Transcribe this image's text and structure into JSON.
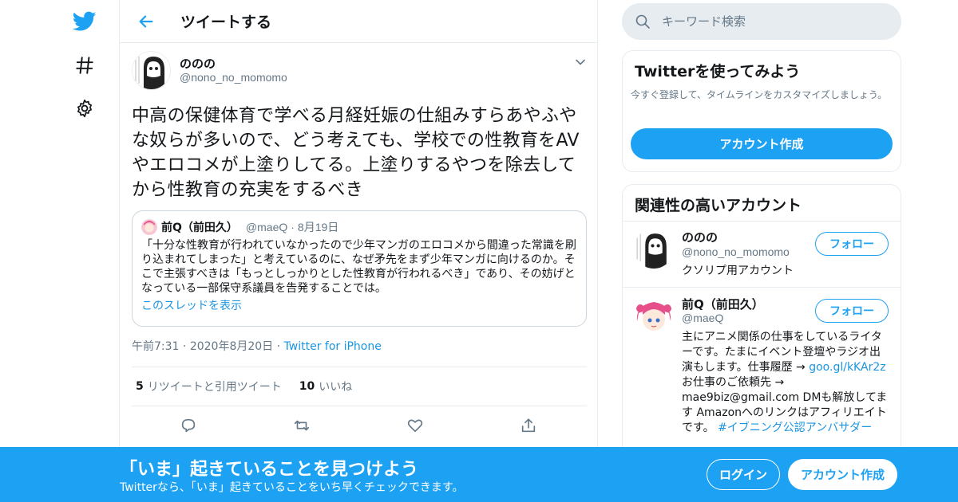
{
  "nav": {
    "icons": [
      "twitter-bird-icon",
      "hashtag-icon",
      "gear-icon"
    ]
  },
  "header": {
    "title": "ツイートする"
  },
  "tweet": {
    "author_name": "ののの",
    "author_handle": "@nono_no_momomo",
    "text": "中高の保健体育で学べる月経妊娠の仕組みすらあやふやな奴らが多いので、どう考えても、学校での性教育をAVやエロコメが上塗りしてる。上塗りするやつを除去してから性教育の充実をするべき",
    "time": "午前7:31",
    "date": "2020年8月20日",
    "source": "Twitter for iPhone",
    "retweets_count": "5",
    "retweets_label": "リツイートと引用ツイート",
    "likes_count": "10",
    "likes_label": "いいね",
    "quote": {
      "name": "前Q（前田久）",
      "handle": "@maeQ",
      "date": "8月19日",
      "text": "「十分な性教育が行われていなかったので少年マンガのエロコメから間違った常識を刷り込まれてしまった」と考えているのに、なぜ矛先をまず少年マンガに向けるのか。そこで主張すべきは「もっとしっかりとした性教育が行われるべき」であり、その妨げとなっている一部保守系議員を告発することでは。",
      "thread_link": "このスレッドを表示"
    }
  },
  "search": {
    "placeholder": "キーワード検索"
  },
  "signup_card": {
    "title": "Twitterを使ってみよう",
    "subtitle": "今すぐ登録して、タイムラインをカスタマイズしましょう。",
    "button": "アカウント作成"
  },
  "related": {
    "title": "関連性の高いアカウント",
    "accounts": [
      {
        "name": "ののの",
        "handle": "@nono_no_momomo",
        "bio": "クソリプ用アカウント",
        "follow": "フォロー"
      },
      {
        "name": "前Q（前田久）",
        "handle": "@maeQ",
        "bio_1": "主にアニメ関係の仕事をしているライターです。たまにイベント登壇やラジオ出演もします。仕事履歴 →",
        "bio_link_1": "goo.gl/kKAr2z",
        "bio_2": "お仕事のご依頼先 → mae9biz@gmail.com DMも解放してます Amazonへのリンクはアフィリエイトです。",
        "bio_link_2": "#イブニング公認アンバサダー",
        "follow": "フォロー"
      }
    ]
  },
  "banner": {
    "title": "「いま」起きていることを見つけよう",
    "subtitle": "Twitterなら、「いま」起きていることをいち早くチェックできます。",
    "login": "ログイン",
    "signup": "アカウント作成"
  },
  "colors": {
    "accent": "#1da1f2",
    "link": "#1b95e0",
    "muted": "#657786",
    "border": "#e6ecf0"
  }
}
